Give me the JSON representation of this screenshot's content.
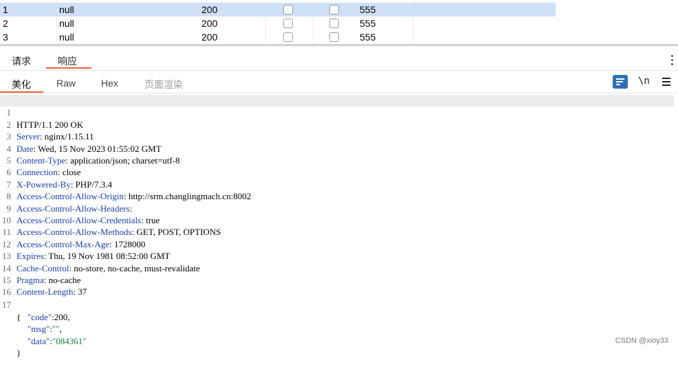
{
  "results_table": {
    "rows": [
      {
        "index": "1",
        "host": "null",
        "status": "200",
        "length": "555"
      },
      {
        "index": "2",
        "host": "null",
        "status": "200",
        "length": "555"
      },
      {
        "index": "3",
        "host": "null",
        "status": "200",
        "length": "555"
      }
    ]
  },
  "message_tabs": [
    "请求",
    "响应"
  ],
  "view_tabs": [
    "美化",
    "Raw",
    "Hex",
    "页面渲染"
  ],
  "toolbar": {
    "newline_label": "\\n"
  },
  "response_headers": [
    {
      "n": "1",
      "key": "",
      "value": "HTTP/1.1 200 OK"
    },
    {
      "n": "2",
      "key": "Server",
      "value": ": nginx/1.15.11"
    },
    {
      "n": "3",
      "key": "Date",
      "value": ": Wed, 15 Nov 2023 01:55:02 GMT"
    },
    {
      "n": "4",
      "key": "Content-Type",
      "value": ": application/json; charset=utf-8"
    },
    {
      "n": "5",
      "key": "Connection",
      "value": ": close"
    },
    {
      "n": "6",
      "key": "X-Powered-By",
      "value": ": PHP/7.3.4"
    },
    {
      "n": "7",
      "key": "Access-Control-Allow-Origin",
      "value": ": http://srm.changlingmach.cn:8002"
    },
    {
      "n": "8",
      "key": "Access-Control-Allow-Headers",
      "value": ":"
    },
    {
      "n": "9",
      "key": "Access-Control-Allow-Credentials",
      "value": ": true"
    },
    {
      "n": "10",
      "key": "Access-Control-Allow-Methods",
      "value": ": GET, POST, OPTIONS"
    },
    {
      "n": "11",
      "key": "Access-Control-Max-Age",
      "value": ": 1728000"
    },
    {
      "n": "12",
      "key": "Expires",
      "value": ": Thu, 19 Nov 1981 08:52:00 GMT"
    },
    {
      "n": "13",
      "key": "Cache-Control",
      "value": ": no-store, no-cache, must-revalidate"
    },
    {
      "n": "14",
      "key": "Pragma",
      "value": ": no-cache"
    },
    {
      "n": "15",
      "key": "Content-Length",
      "value": ": 37"
    },
    {
      "n": "16",
      "key": "",
      "value": ""
    }
  ],
  "body": {
    "line_number": "17",
    "open_brace": "{",
    "close_brace": "}",
    "fields": [
      {
        "key": "\"code\"",
        "sep": ":",
        "value": "200",
        "tail": ",",
        "type": "num"
      },
      {
        "key": "\"msg\"",
        "sep": ":",
        "value": "\"\"",
        "tail": ",",
        "type": "str"
      },
      {
        "key": "\"data\"",
        "sep": ":",
        "value": "\"084361\"",
        "tail": "",
        "type": "str"
      }
    ]
  },
  "watermark": "CSDN @xioy33"
}
